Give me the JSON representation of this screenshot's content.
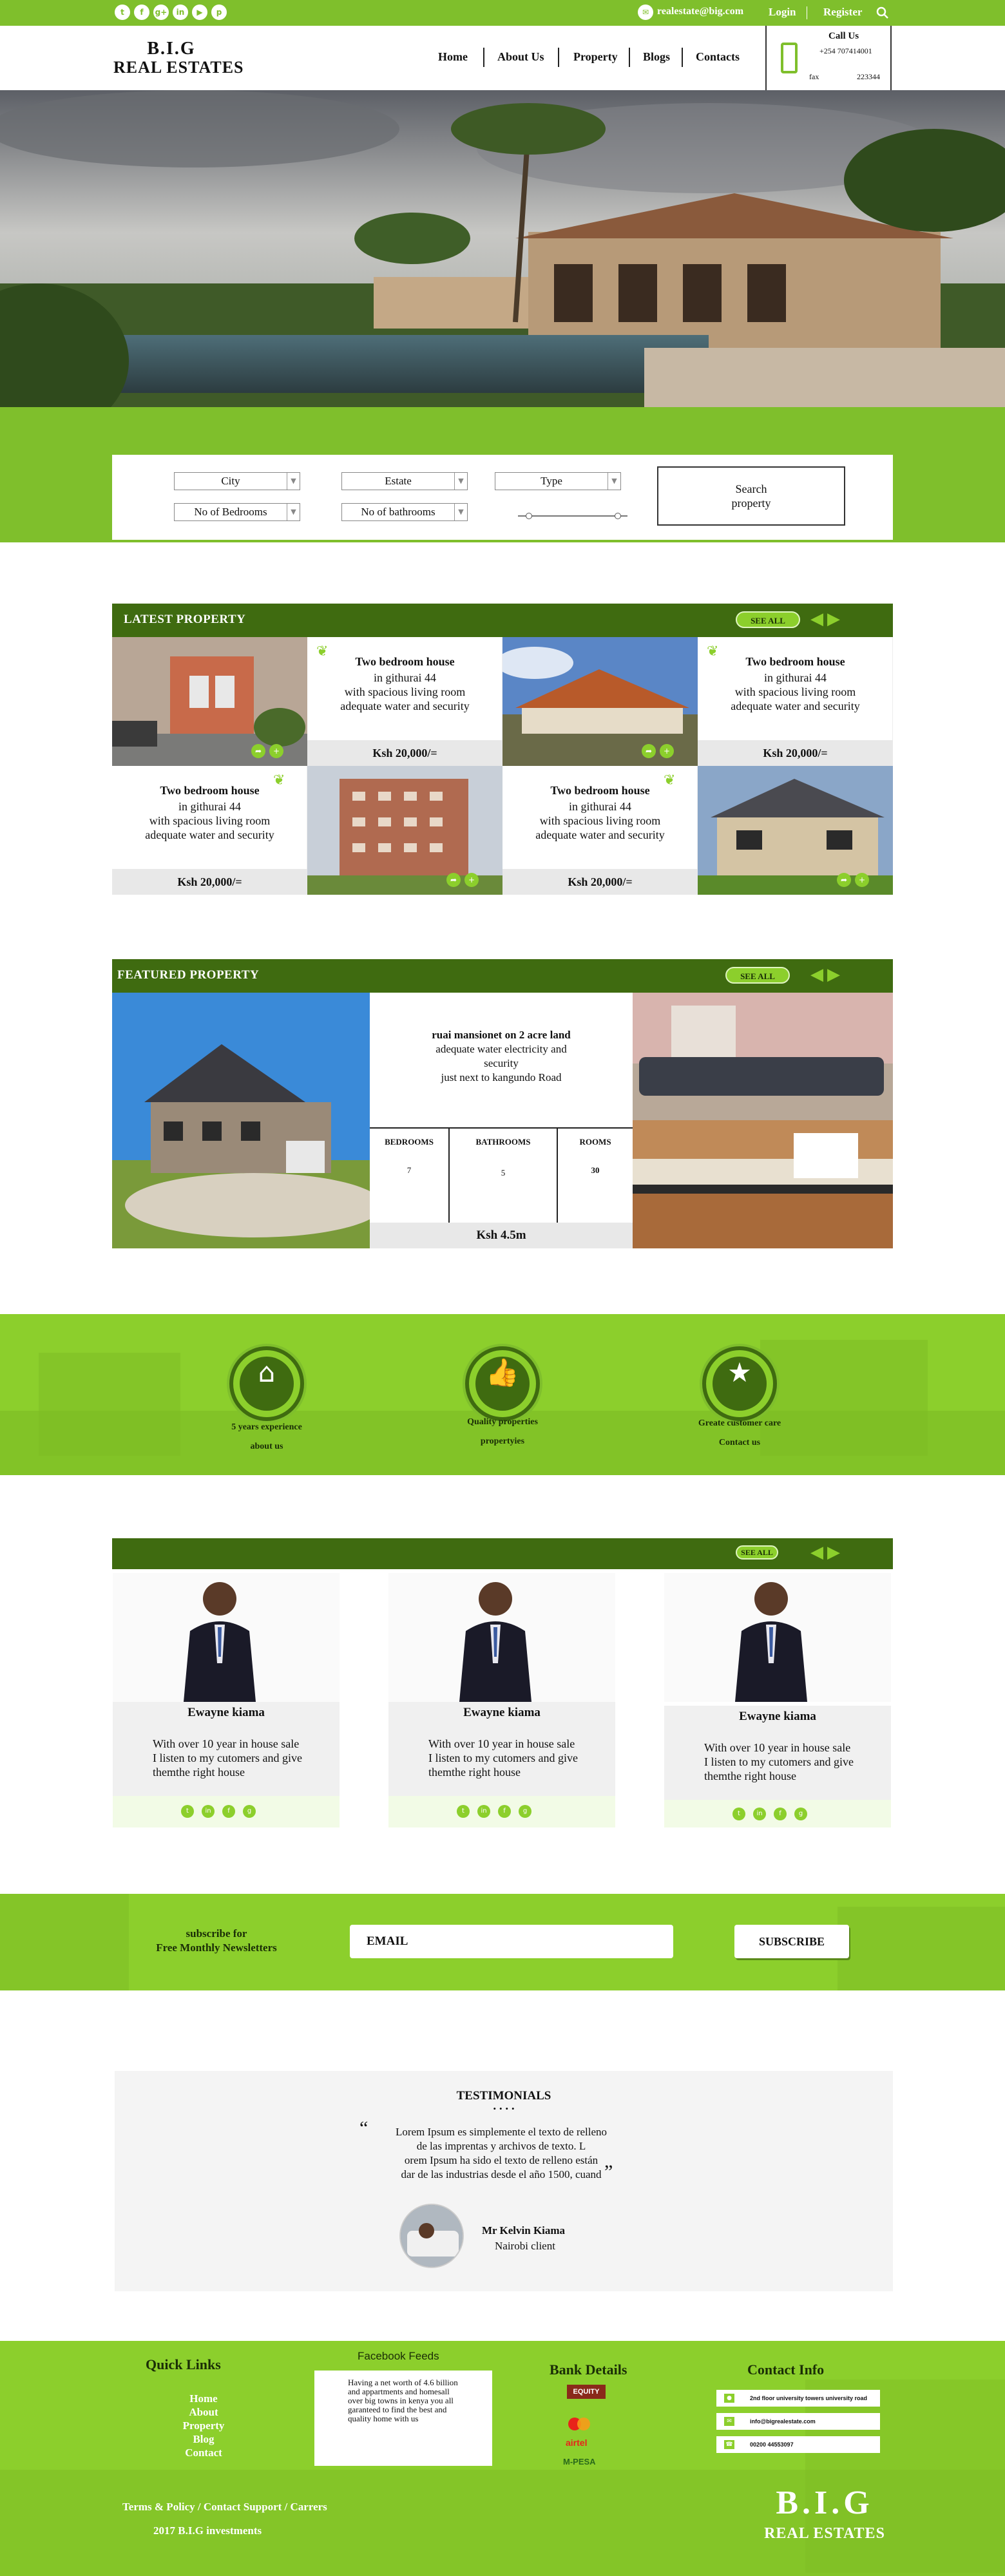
{
  "topbar": {
    "social_icons": [
      "twitter-icon",
      "facebook-icon",
      "google-plus-icon",
      "linkedin-icon",
      "youtube-icon",
      "pinterest-icon"
    ],
    "email": "realestate@big.com",
    "login": "Login",
    "register": "Register",
    "search_icon": "search-icon"
  },
  "header": {
    "logo_line1": "B.I.G",
    "logo_line2": "REAL ESTATES",
    "nav": [
      "Home",
      "About Us",
      "Property",
      "Blogs",
      "Contacts"
    ],
    "call_title": "Call Us",
    "phone": "+254 707414001",
    "fax_label": "fax",
    "fax": "223344"
  },
  "search": {
    "city": "City",
    "estate": "Estate",
    "type": "Type",
    "bedrooms": "No of Bedrooms",
    "bathrooms": "No of bathrooms",
    "button_line1": "Search",
    "button_line2": "property"
  },
  "latest": {
    "title": "LATEST  PROPERTY",
    "see_all": "SEE ALL",
    "card_heading": "Two bedroom house",
    "card_line1": "in githurai 44",
    "card_line2a": "with spacious living room",
    "card_line2b": "with spacious living room",
    "card_line3": "adequate water and security",
    "price": "Ksh 20,000/="
  },
  "featured": {
    "title": "FEATURED PROPERTY",
    "see_all": "SEE ALL",
    "heading": "ruai mansionet on 2 acre land",
    "line1": "adequate water electricity  and",
    "line2": "security",
    "line3": "just next to kangundo Road",
    "labels": [
      "BEDROOMS",
      "BATHROOMS",
      "ROOMS"
    ],
    "values": [
      "7",
      "5",
      "30"
    ],
    "price": "Ksh 4.5m"
  },
  "features": [
    {
      "icon": "home-icon",
      "line1": "5 years experience",
      "line2": "about us"
    },
    {
      "icon": "thumbs-up-icon",
      "line1": "Quality properties",
      "line2": "propertyies"
    },
    {
      "icon": "star-icon",
      "line1": "Greate customer care",
      "line2": "Contact us"
    }
  ],
  "agents": {
    "see_all": "SEE ALL",
    "name": "Ewayne kiama",
    "bio1": "With over 10 year in house sale",
    "bio2": "I listen to my cutomers and give",
    "bio3": "themthe right house"
  },
  "newsletter": {
    "line1": "subscribe for",
    "line2": "Free Monthly Newsletters",
    "placeholder": "EMAIL",
    "button": "SUBSCRIBE"
  },
  "testimonials": {
    "title": "TESTIMONIALS",
    "dots": ". . . .",
    "quote1": "Lorem Ipsum es simplemente el texto de relleno",
    "quote2": "de las imprentas y archivos de texto. L",
    "quote3": "orem Ipsum ha sido el texto de relleno están",
    "quote4": "dar de las industrias desde el año 1500, cuand",
    "name": "Mr Kelvin Kiama",
    "role": "Nairobi client"
  },
  "footer": {
    "quick_links_title": "Quick Links",
    "links": [
      "Home",
      "About",
      "Property",
      "Blog",
      "Contact"
    ],
    "fb_title": "Facebook Feeds",
    "fb_text1": "Having a net worth of 4.6 billion",
    "fb_text2": "and appartments and homesall",
    "fb_text3": "over big towns in kenya you all",
    "fb_text4": "garanteed to find the best and",
    "fb_text5": "quality home with us",
    "bank_title": "Bank Details",
    "banks": [
      "EQUITY",
      "MasterCard",
      "airtel",
      "M-PESA"
    ],
    "contact_title": "Contact Info",
    "contact_address": "2nd floor university towers university road",
    "contact_email": "info@bigrealestate.com",
    "contact_phone": "00200 44553097",
    "terms": "Terms & Policy / Contact Support / Carrers",
    "copyright": "2017 B.I.G investments",
    "logo_line1": "B.I.G",
    "logo_line2": "REAL ESTATES"
  },
  "colors": {
    "green": "#8ccf2c",
    "dark_green": "#3f6b10",
    "top_green": "#7fbf2c"
  }
}
